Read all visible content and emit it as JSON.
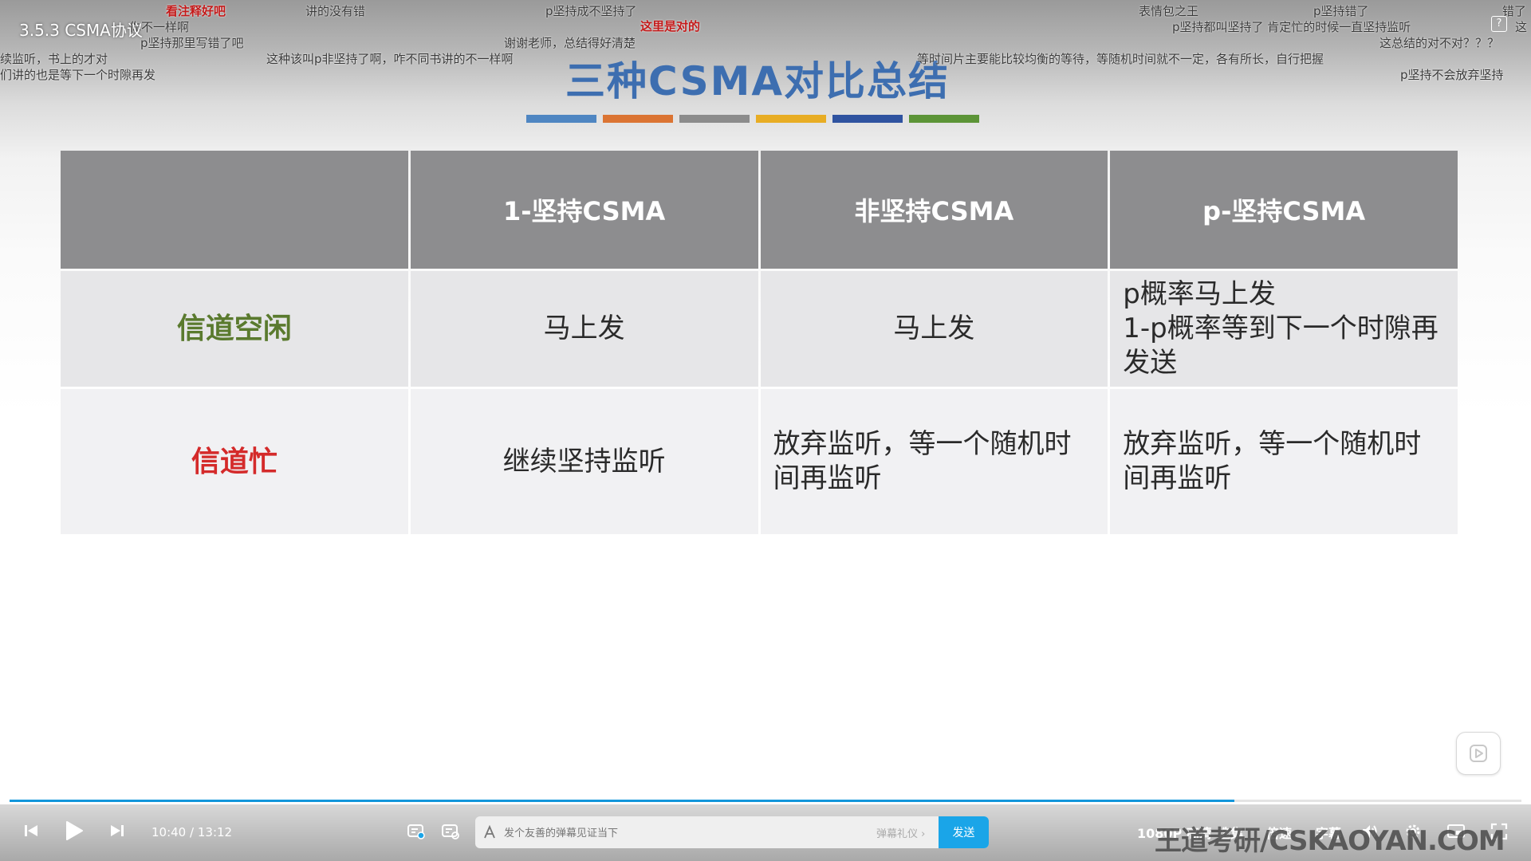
{
  "video": {
    "title": "3.5.3 CSMA协议",
    "help_icon": "question-mark-icon"
  },
  "danmaku": [
    {
      "text": "看注释好吧",
      "style": "red"
    },
    {
      "text": "讲的没有错",
      "style": "normal"
    },
    {
      "text": "p坚持成不坚持了",
      "style": "normal"
    },
    {
      "text": "这里是对的",
      "style": "red"
    },
    {
      "text": "表情包之王",
      "style": "normal"
    },
    {
      "text": "p坚持错了",
      "style": "normal"
    },
    {
      "text": "错了",
      "style": "normal"
    },
    {
      "text": "你不一样啊",
      "style": "normal"
    },
    {
      "text": "p坚持都叫坚持了 肯定忙的时候一直坚持监听",
      "style": "normal"
    },
    {
      "text": "这",
      "style": "normal"
    },
    {
      "text": "p坚持那里写错了吧",
      "style": "normal"
    },
    {
      "text": "谢谢老师，总结得好清楚",
      "style": "normal"
    },
    {
      "text": "这总结的对不对？？？",
      "style": "normal"
    },
    {
      "text": "续监听，书上的才对",
      "style": "normal"
    },
    {
      "text": "这种该叫p非坚持了啊，咋不同书讲的不一样啊",
      "style": "normal"
    },
    {
      "text": "等时间片主要能比较均衡的等待，等随机时间就不一定，各有所长，自行把握",
      "style": "normal"
    },
    {
      "text": "们讲的也是等下一个时隙再发",
      "style": "normal"
    },
    {
      "text": "p坚持不会放弃坚持",
      "style": "normal"
    }
  ],
  "slide": {
    "title": "三种CSMA对比总结",
    "bar_colors": [
      "#4f86c2",
      "#db7433",
      "#8c8c8c",
      "#e8ad24",
      "#2f53a0",
      "#5c9437"
    ],
    "table": {
      "headers": [
        "",
        "1-坚持CSMA",
        "非坚持CSMA",
        "p-坚持CSMA"
      ],
      "rows": [
        {
          "label": "信道空闲",
          "label_color": "#5a7a2e",
          "cells": [
            "马上发",
            "马上发"
          ],
          "p_lines": [
            "p概率马上发",
            "1-p概率等到下一个时隙再发送"
          ]
        },
        {
          "label": "信道忙",
          "label_color": "#d42a2a",
          "cells": [
            "继续坚持监听",
            "放弃监听，等一个随机时间再监听",
            "放弃监听，等一个随机时间再监听"
          ]
        }
      ]
    }
  },
  "player": {
    "progress_fraction": 0.81,
    "time_current": "10:40",
    "time_separator": "/",
    "time_total": "13:12",
    "danmaku_placeholder": "发个友善的弹幕见证当下",
    "danmaku_etiquette": "弹幕礼仪 ›",
    "send_label": "发送",
    "quality_label": "1080P 高清",
    "episodes_label": "选集",
    "speed_label": "倍速",
    "subtitle_label": "字幕",
    "icons": {
      "prev": "skip-previous-icon",
      "play": "play-icon",
      "next": "skip-next-icon",
      "danmaku_toggle": "danmaku-toggle-icon",
      "danmaku_settings": "danmaku-settings-icon",
      "volume": "volume-icon",
      "settings": "gear-icon",
      "pip": "picture-in-picture-icon",
      "fullscreen": "fullscreen-icon",
      "replay": "replay-icon"
    }
  },
  "watermark": "王道考研/CSKAOYAN.COM"
}
